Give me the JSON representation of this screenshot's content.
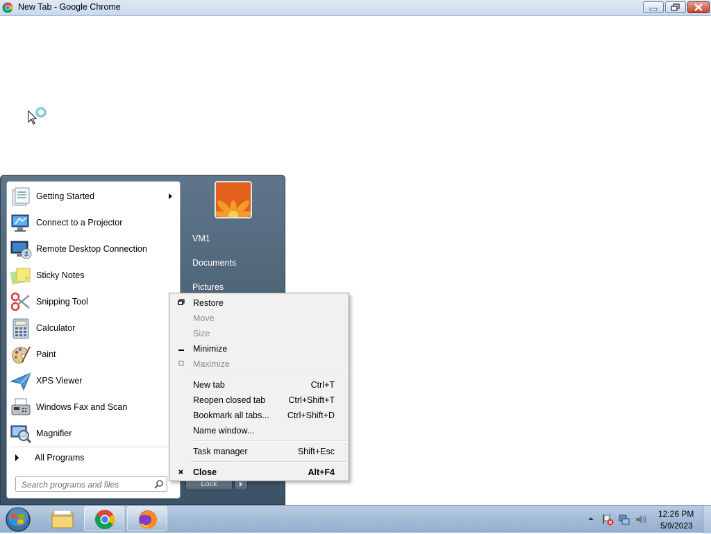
{
  "window": {
    "title": "New Tab - Google Chrome"
  },
  "start_menu": {
    "programs": [
      {
        "label": "Getting Started",
        "icon": "getting-started-icon",
        "has_submenu": true
      },
      {
        "label": "Connect to a Projector",
        "icon": "projector-icon"
      },
      {
        "label": "Remote Desktop Connection",
        "icon": "remote-desktop-icon"
      },
      {
        "label": "Sticky Notes",
        "icon": "sticky-notes-icon"
      },
      {
        "label": "Snipping Tool",
        "icon": "scissors-icon"
      },
      {
        "label": "Calculator",
        "icon": "calculator-icon"
      },
      {
        "label": "Paint",
        "icon": "paint-palette-icon"
      },
      {
        "label": "XPS Viewer",
        "icon": "xps-viewer-icon"
      },
      {
        "label": "Windows Fax and Scan",
        "icon": "fax-icon"
      },
      {
        "label": "Magnifier",
        "icon": "magnifier-icon"
      }
    ],
    "all_programs": "All Programs",
    "search_placeholder": "Search programs and files",
    "right_links": [
      "VM1",
      "Documents",
      "Pictures"
    ],
    "lock_label": "Lock"
  },
  "context_menu": {
    "groups": [
      [
        {
          "label": "Restore",
          "enabled": true,
          "glyph": "restore"
        },
        {
          "label": "Move",
          "enabled": false
        },
        {
          "label": "Size",
          "enabled": false
        },
        {
          "label": "Minimize",
          "enabled": true,
          "glyph": "minimize"
        },
        {
          "label": "Maximize",
          "enabled": false,
          "glyph": "maximize"
        }
      ],
      [
        {
          "label": "New tab",
          "shortcut": "Ctrl+T",
          "enabled": true
        },
        {
          "label": "Reopen closed tab",
          "shortcut": "Ctrl+Shift+T",
          "enabled": true
        },
        {
          "label": "Bookmark all tabs...",
          "shortcut": "Ctrl+Shift+D",
          "enabled": true
        },
        {
          "label": "Name window...",
          "enabled": true
        }
      ],
      [
        {
          "label": "Task manager",
          "shortcut": "Shift+Esc",
          "enabled": true
        }
      ],
      [
        {
          "label": "Close",
          "shortcut": "Alt+F4",
          "enabled": true,
          "bold": true,
          "glyph": "close"
        }
      ]
    ]
  },
  "taskbar": {
    "apps": [
      "file-explorer-icon",
      "chrome-icon",
      "firefox-icon"
    ],
    "clock": {
      "time": "12:26 PM",
      "date": "5/9/2023"
    }
  }
}
